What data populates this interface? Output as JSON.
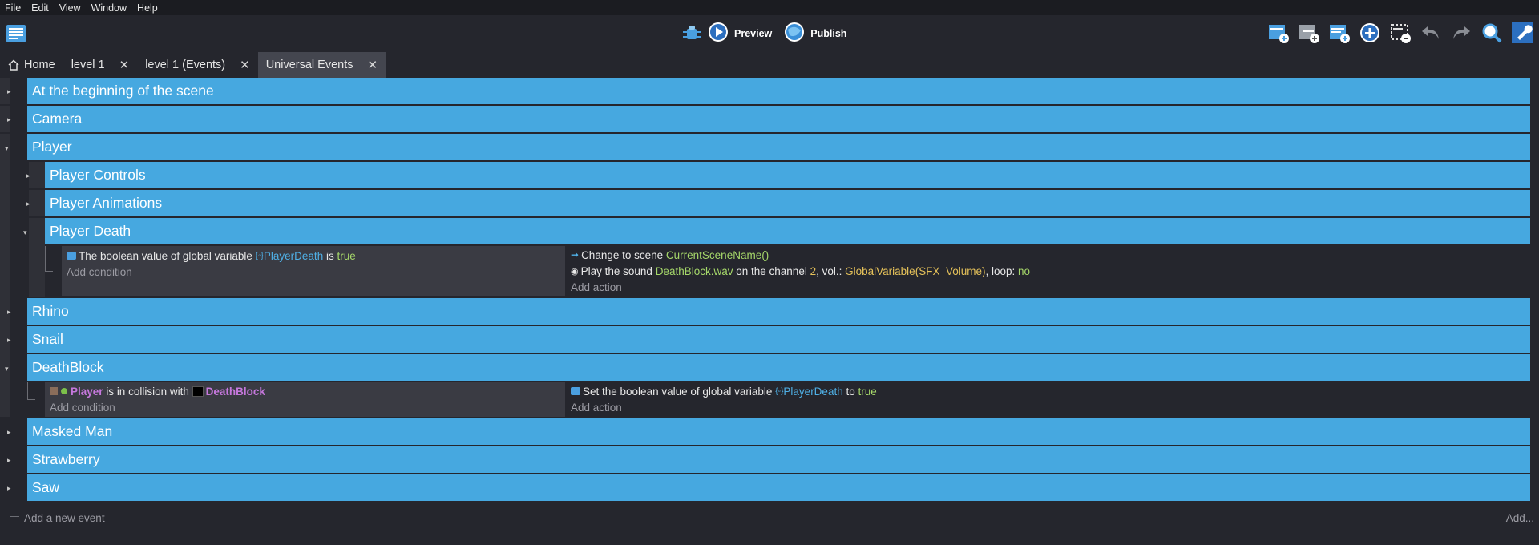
{
  "menu": [
    "File",
    "Edit",
    "View",
    "Window",
    "Help"
  ],
  "toolbar": {
    "preview_label": "Preview",
    "publish_label": "Publish",
    "right_icons": [
      "add-event-icon",
      "add-sub-event-icon",
      "add-comment-icon",
      "add-other-icon",
      "delete-icon",
      "undo-icon",
      "redo-icon",
      "search-icon",
      "settings-wrench-icon"
    ]
  },
  "tabs": [
    {
      "label": "Home",
      "closable": false
    },
    {
      "label": "level 1",
      "closable": true
    },
    {
      "label": "level 1 (Events)",
      "closable": true
    },
    {
      "label": "Universal Events",
      "closable": true,
      "active": true
    }
  ],
  "groups": {
    "beginning": "At the beginning of the scene",
    "camera": "Camera",
    "player": "Player",
    "player_controls": "Player Controls",
    "player_animations": "Player Animations",
    "player_death": "Player Death",
    "rhino": "Rhino",
    "snail": "Snail",
    "deathblock": "DeathBlock",
    "masked_man": "Masked Man",
    "strawberry": "Strawberry",
    "saw": "Saw"
  },
  "player_death_event": {
    "condition": {
      "text": "The boolean value of global variable",
      "variable": "PlayerDeath",
      "is": "is",
      "value": "true"
    },
    "add_condition": "Add condition",
    "action1": {
      "text": "Change to scene",
      "value": "CurrentSceneName()"
    },
    "action2": {
      "text": "Play the sound",
      "sound": "DeathBlock.wav",
      "channel_text": "on the channel",
      "channel": "2",
      "vol_text": ", vol.:",
      "vol": "GlobalVariable(SFX_Volume)",
      "loop_text": ", loop:",
      "loop": "no"
    },
    "add_action": "Add action"
  },
  "deathblock_event": {
    "condition": {
      "object1": "Player",
      "text": "is in collision with",
      "object2": "DeathBlock"
    },
    "add_condition": "Add condition",
    "action": {
      "text": "Set the boolean value of global variable",
      "variable": "PlayerDeath",
      "to": "to",
      "value": "true"
    },
    "add_action": "Add action"
  },
  "footer": {
    "add_event": "Add a new event",
    "add_more": "Add..."
  },
  "colors": {
    "group_bar": "#46a8e0",
    "background": "#25262d",
    "condition_bg": "#3a3b43"
  }
}
